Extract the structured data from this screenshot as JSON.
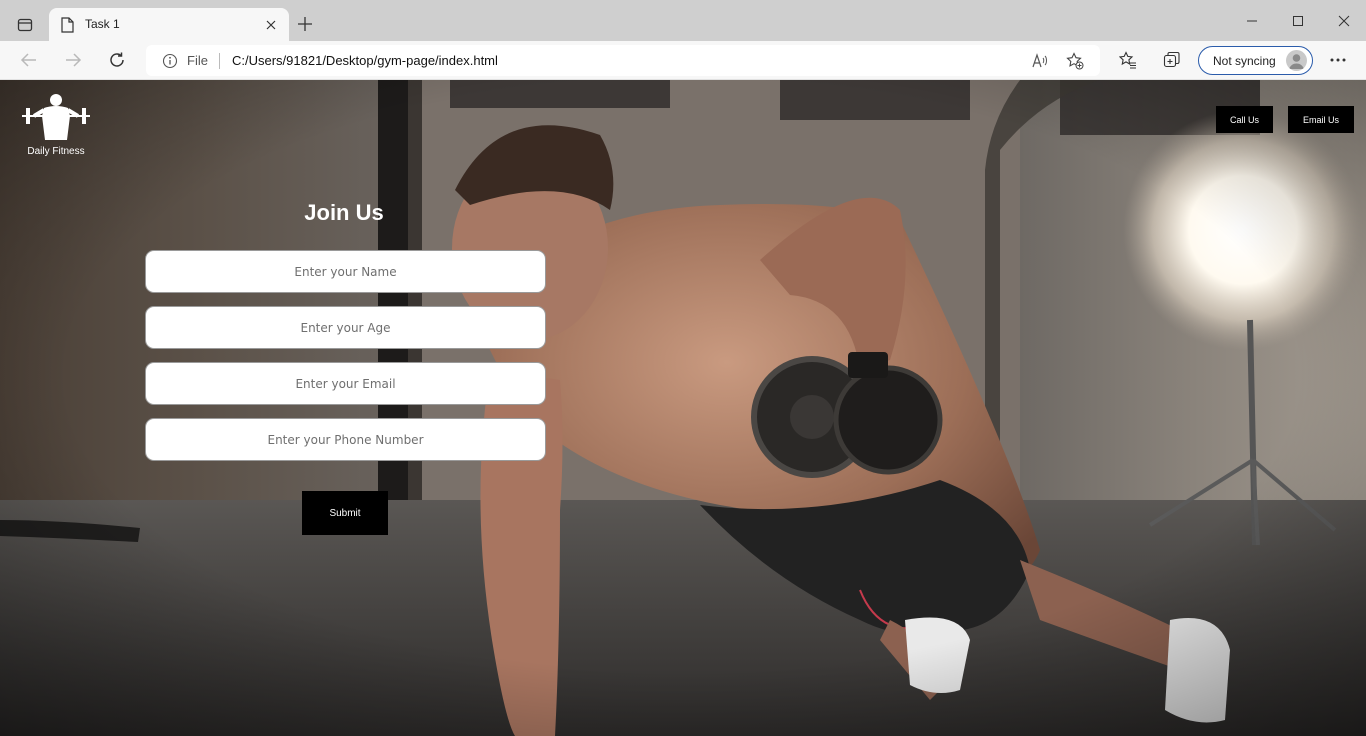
{
  "browser": {
    "tab_title": "Task 1",
    "address_prefix": "File",
    "url": "C:/Users/91821/Desktop/gym-page/index.html",
    "profile_label": "Not syncing"
  },
  "page": {
    "brand": "Daily Fitness",
    "call_label": "Call Us",
    "email_label": "Email Us",
    "form": {
      "title": "Join Us",
      "name_placeholder": "Enter your Name",
      "age_placeholder": "Enter your Age",
      "email_placeholder": "Enter your Email",
      "phone_placeholder": "Enter your Phone Number",
      "submit_label": "Submit"
    }
  },
  "colors": {
    "accent": "#2b5cab",
    "button_bg": "#000000",
    "text_light": "#ffffff"
  }
}
